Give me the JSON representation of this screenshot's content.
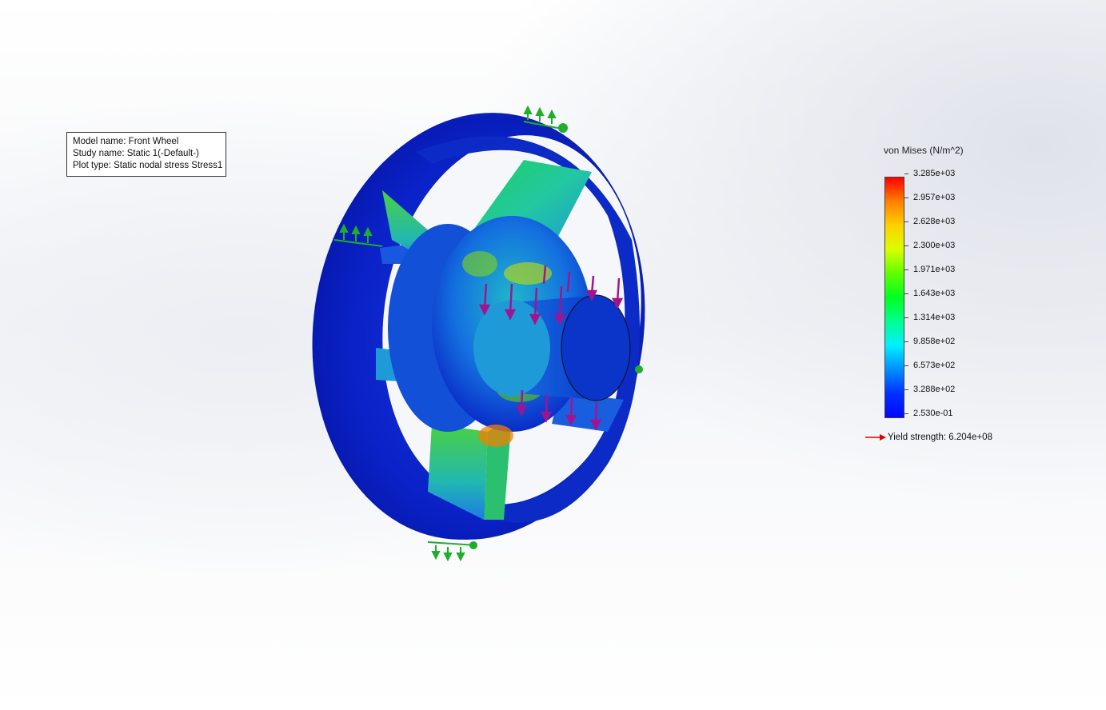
{
  "info": {
    "model_name": "Model name: Front Wheel",
    "study_name": "Study name: Static 1(-Default-)",
    "plot_type": "Plot type: Static nodal stress Stress1"
  },
  "legend": {
    "title": "von Mises (N/m^2)",
    "ticks": [
      "3.285e+03",
      "2.957e+03",
      "2.628e+03",
      "2.300e+03",
      "1.971e+03",
      "1.643e+03",
      "1.314e+03",
      "9.858e+02",
      "6.573e+02",
      "3.288e+02",
      "2.530e-01"
    ],
    "yield_label": "Yield strength: 6.204e+08"
  },
  "colors": {
    "fixture": "#1fae2a",
    "load": "#a0158f",
    "yield_arrow": "#e00000"
  }
}
